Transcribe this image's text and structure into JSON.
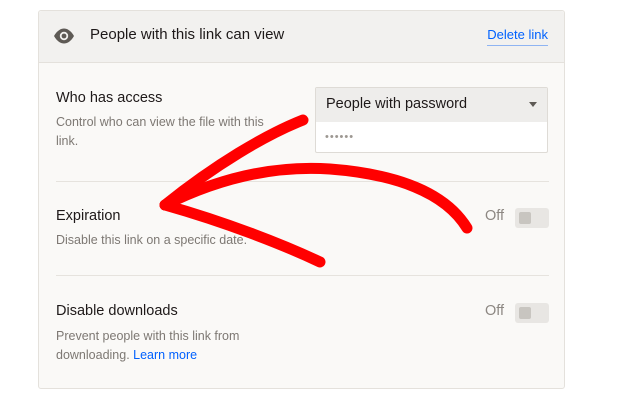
{
  "header": {
    "title": "People with this link can view",
    "delete_link_label": "Delete link",
    "icon": "eye-icon"
  },
  "access": {
    "title": "Who has access",
    "description": "Control who can view the file with this link.",
    "select_value": "People with password",
    "password_mask": "••••••"
  },
  "expiration": {
    "title": "Expiration",
    "description": "Disable this link on a specific date.",
    "toggle_label": "Off",
    "toggle_on": false
  },
  "downloads": {
    "title": "Disable downloads",
    "description": "Prevent people with this link from downloading.",
    "learn_more_label": "Learn more",
    "toggle_label": "Off",
    "toggle_on": false
  },
  "colors": {
    "link": "#0061fe",
    "annotation_arrow": "#ff0000",
    "panel_bg": "#faf9f7",
    "header_bg": "#f2f1ef"
  }
}
